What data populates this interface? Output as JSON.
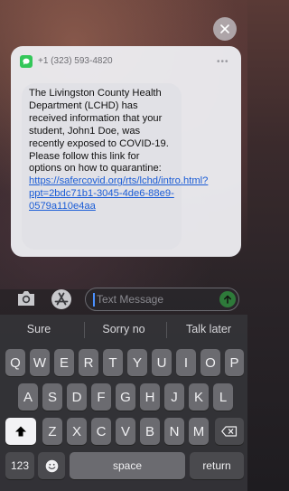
{
  "notification": {
    "sender": "+1 (323) 593-4820",
    "more": "•••",
    "message_text": "The Livingston County Health Department (LCHD) has received information that your student, John1 Doe, was recently exposed to COVID-19.  Please follow this link for options on how to quarantine: ",
    "message_link": "https://safercovid.org/rts/lchd/intro.html?ppt=2bdc71b1-3045-4de6-88e9-0579a110e4aa"
  },
  "compose": {
    "placeholder": "Text Message"
  },
  "suggestions": [
    "Sure",
    "Sorry no",
    "Talk later"
  ],
  "keyboard": {
    "row1": [
      "Q",
      "W",
      "E",
      "R",
      "T",
      "Y",
      "U",
      "I",
      "O",
      "P"
    ],
    "row2": [
      "A",
      "S",
      "D",
      "F",
      "G",
      "H",
      "J",
      "K",
      "L"
    ],
    "row3": [
      "Z",
      "X",
      "C",
      "V",
      "B",
      "N",
      "M"
    ],
    "numbers_label": "123",
    "space_label": "space",
    "return_label": "return"
  },
  "colors": {
    "imessage_green": "#34c759",
    "link_blue": "#1a5cd6"
  }
}
